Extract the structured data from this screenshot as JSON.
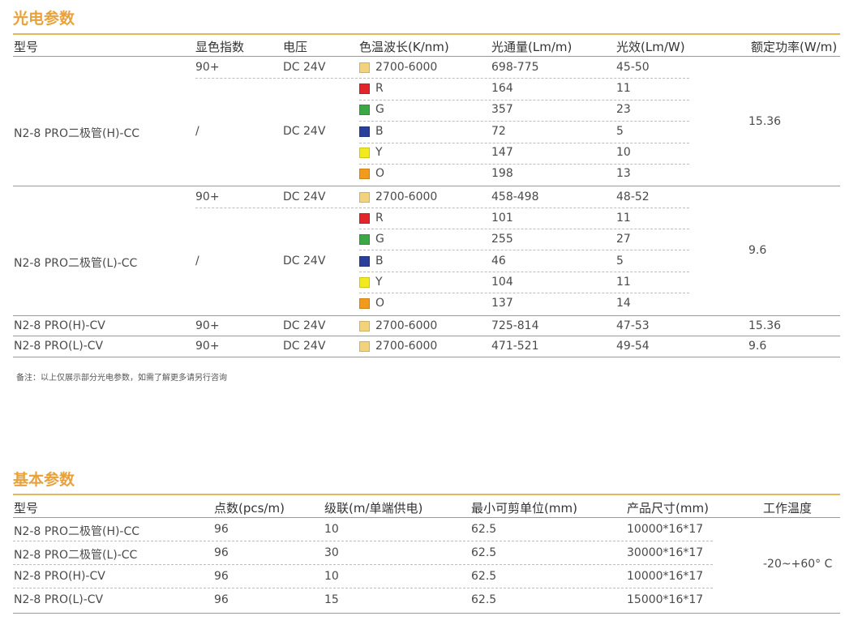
{
  "section1": {
    "title": "光电参数",
    "headers": [
      "型号",
      "显色指数",
      "电压",
      "色温波长(K/nm)",
      "光通量(Lm/m)",
      "光效(Lm/W)",
      "额定功率(W/m)"
    ],
    "groups": [
      {
        "model": "N2-8 PRO二极管(H)-CC",
        "power": "15.36",
        "rows": [
          {
            "cri": "90+",
            "voltage": "DC 24V",
            "color": "#f3d27c",
            "cct": "2700-6000",
            "flux": "698-775",
            "eff": "45-50"
          },
          {
            "cri": "",
            "voltage": "",
            "color": "#e0262c",
            "cct": "R",
            "flux": "164",
            "eff": "11"
          },
          {
            "cri": "/",
            "voltage": "DC 24V",
            "color": "#3aa845",
            "cct": "G",
            "flux": "357",
            "eff": "23"
          },
          {
            "cri": "",
            "voltage": "",
            "color": "#2a3f9a",
            "cct": "B",
            "flux": "72",
            "eff": "5"
          },
          {
            "cri": "",
            "voltage": "",
            "color": "#f2ea1a",
            "cct": "Y",
            "flux": "147",
            "eff": "10"
          },
          {
            "cri": "",
            "voltage": "",
            "color": "#f19a1c",
            "cct": "O",
            "flux": "198",
            "eff": "13"
          }
        ]
      },
      {
        "model": "N2-8 PRO二极管(L)-CC",
        "power": "9.6",
        "rows": [
          {
            "cri": "90+",
            "voltage": "DC 24V",
            "color": "#f3d27c",
            "cct": "2700-6000",
            "flux": "458-498",
            "eff": "48-52"
          },
          {
            "cri": "",
            "voltage": "",
            "color": "#e0262c",
            "cct": "R",
            "flux": "101",
            "eff": "11"
          },
          {
            "cri": "",
            "voltage": "",
            "color": "#3aa845",
            "cct": "G",
            "flux": "255",
            "eff": "27"
          },
          {
            "cri": "/",
            "voltage": "DC 24V",
            "color": "#2a3f9a",
            "cct": "B",
            "flux": "46",
            "eff": "5"
          },
          {
            "cri": "",
            "voltage": "",
            "color": "#f2ea1a",
            "cct": "Y",
            "flux": "104",
            "eff": "11"
          },
          {
            "cri": "",
            "voltage": "",
            "color": "#f19a1c",
            "cct": "O",
            "flux": "137",
            "eff": "14"
          }
        ]
      }
    ],
    "singles": [
      {
        "model": "N2-8 PRO(H)-CV",
        "cri": "90+",
        "voltage": "DC 24V",
        "color": "#f3d27c",
        "cct": "2700-6000",
        "flux": "725-814",
        "eff": "47-53",
        "power": "15.36"
      },
      {
        "model": "N2-8 PRO(L)-CV",
        "cri": "90+",
        "voltage": "DC 24V",
        "color": "#f3d27c",
        "cct": "2700-6000",
        "flux": "471-521",
        "eff": "49-54",
        "power": "9.6"
      }
    ],
    "note": "备注：以上仅展示部分光电参数，如需了解更多请另行咨询"
  },
  "section2": {
    "title": "基本参数",
    "headers": [
      "型号",
      "点数(pcs/m)",
      "级联(m/单端供电)",
      "最小可剪单位(mm)",
      "产品尺寸(mm)",
      "工作温度"
    ],
    "rows": [
      {
        "model": "N2-8 PRO二极管(H)-CC",
        "points": "96",
        "cascade": "10",
        "cut": "62.5",
        "size": "10000*16*17"
      },
      {
        "model": "N2-8 PRO二极管(L)-CC",
        "points": "96",
        "cascade": "30",
        "cut": "62.5",
        "size": "30000*16*17"
      },
      {
        "model": "N2-8 PRO(H)-CV",
        "points": "96",
        "cascade": "10",
        "cut": "62.5",
        "size": "10000*16*17"
      },
      {
        "model": "N2-8 PRO(L)-CV",
        "points": "96",
        "cascade": "15",
        "cut": "62.5",
        "size": "15000*16*17"
      }
    ],
    "temp": "-20~+60° C"
  }
}
